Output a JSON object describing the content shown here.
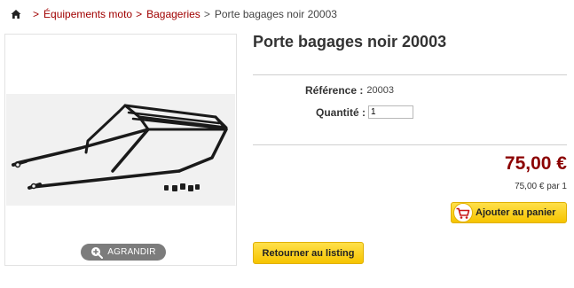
{
  "breadcrumb": {
    "home_icon": "home-icon",
    "separator": ">",
    "items": [
      "Équipements moto",
      "Bagageries"
    ],
    "current": "Porte bagages noir 20003"
  },
  "product": {
    "title": "Porte bagages noir 20003",
    "zoom_label": "AGRANDIR",
    "reference_label": "Référence :",
    "reference_value": "20003",
    "quantity_label": "Quantité :",
    "quantity_value": "1",
    "price": "75,00 €",
    "unit_price": "75,00 € par 1",
    "add_to_cart_label": "Ajouter au panier",
    "back_label": "Retourner au listing"
  },
  "colors": {
    "link": "#a00000",
    "price": "#8b0000",
    "button": "#f6c400"
  }
}
